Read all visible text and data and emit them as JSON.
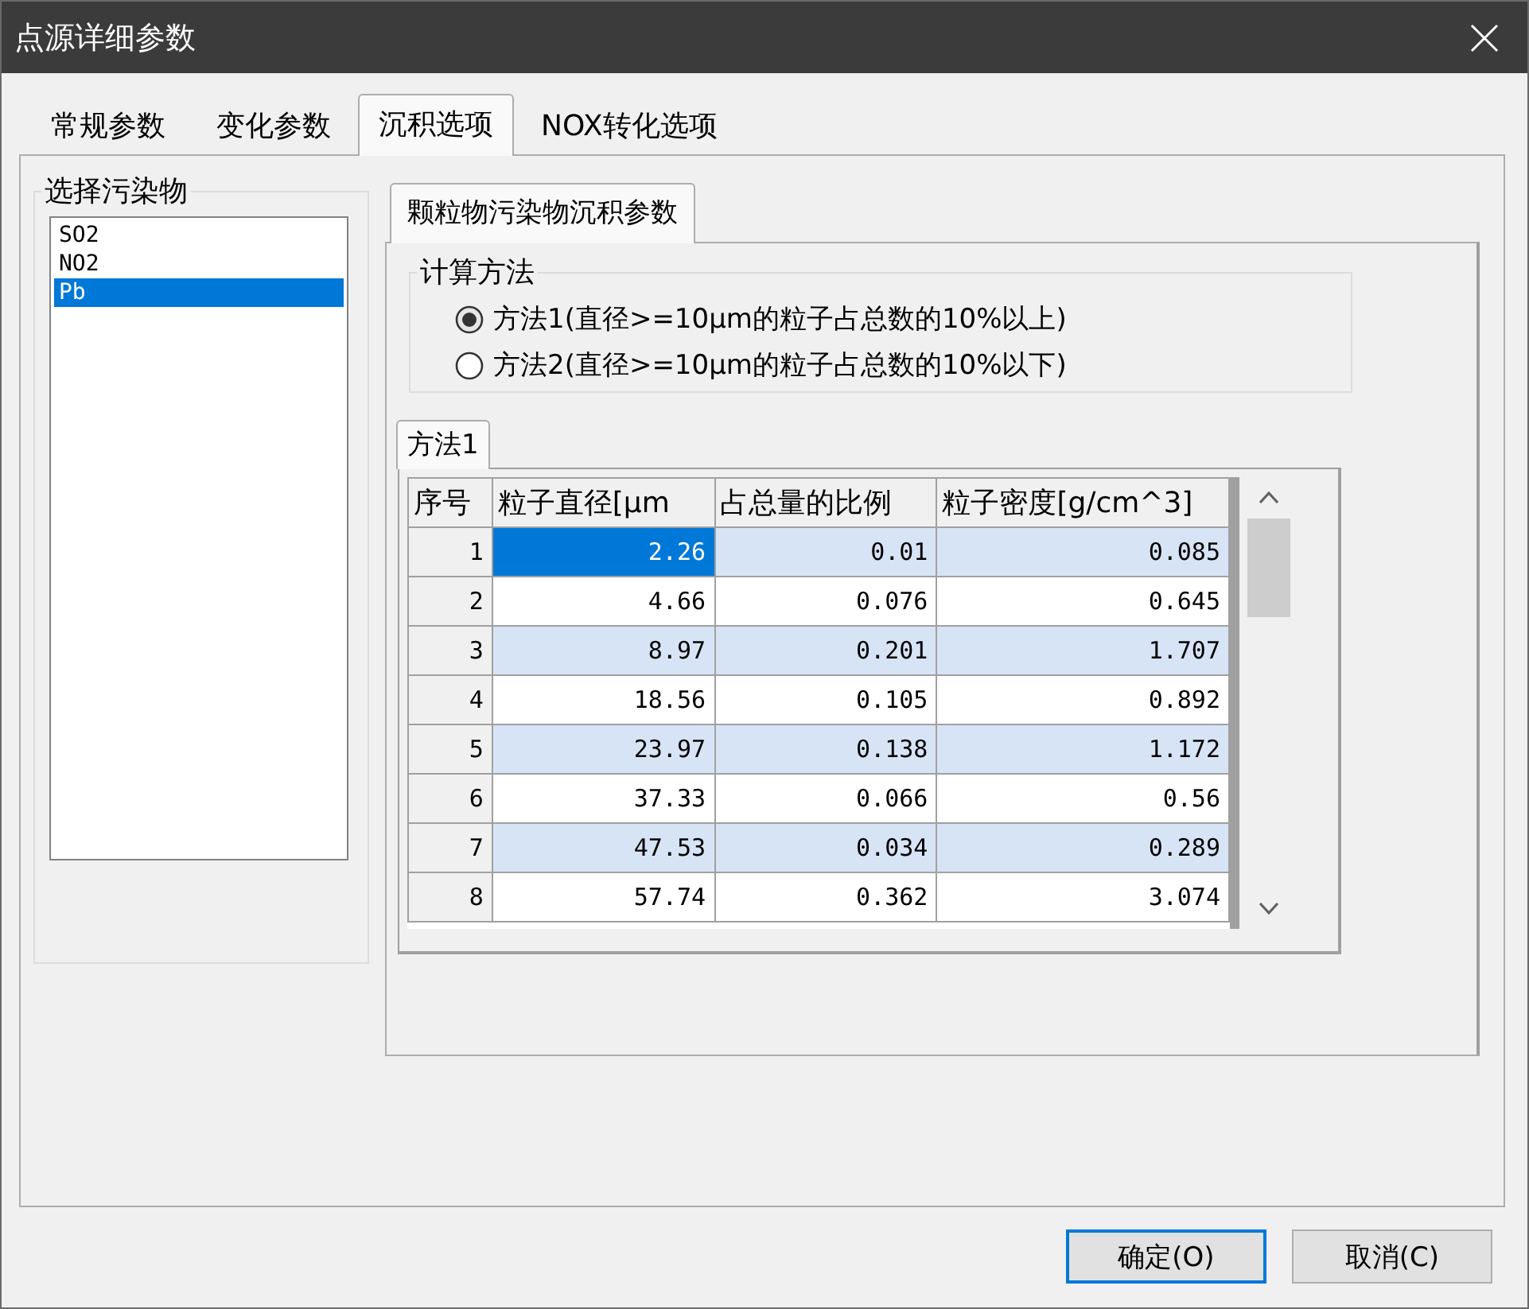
{
  "window": {
    "title": "点源详细参数"
  },
  "tabs": [
    {
      "label": "常规参数",
      "selected": false
    },
    {
      "label": "变化参数",
      "selected": false
    },
    {
      "label": "沉积选项",
      "selected": true
    },
    {
      "label": "NOX转化选项",
      "selected": false
    }
  ],
  "pollutants": {
    "title": "选择污染物",
    "items": [
      {
        "label": "SO2",
        "selected": false
      },
      {
        "label": "NO2",
        "selected": false
      },
      {
        "label": "Pb",
        "selected": true
      }
    ]
  },
  "inner_tabs": [
    {
      "label": "颗粒物污染物沉积参数",
      "selected": true
    }
  ],
  "method": {
    "title": "计算方法",
    "options": [
      {
        "label": "方法1(直径>=10μm的粒子占总数的10%以上)",
        "selected": true
      },
      {
        "label": "方法2(直径>=10μm的粒子占总数的10%以下)",
        "selected": false
      }
    ]
  },
  "table_tabs": [
    {
      "label": "方法1",
      "selected": true
    }
  ],
  "table": {
    "columns": [
      "序号",
      "粒子直径[μm",
      "占总量的比例",
      "粒子密度[g/cm^3]"
    ],
    "rows": [
      {
        "cells": [
          {
            "text": "1",
            "selected": false
          },
          {
            "text": "2.26",
            "selected": true
          },
          {
            "text": "0.01",
            "selected": false
          },
          {
            "text": "0.085",
            "selected": false
          }
        ]
      },
      {
        "cells": [
          {
            "text": "2",
            "selected": false
          },
          {
            "text": "4.66",
            "selected": false
          },
          {
            "text": "0.076",
            "selected": false
          },
          {
            "text": "0.645",
            "selected": false
          }
        ]
      },
      {
        "cells": [
          {
            "text": "3",
            "selected": false
          },
          {
            "text": "8.97",
            "selected": false
          },
          {
            "text": "0.201",
            "selected": false
          },
          {
            "text": "1.707",
            "selected": false
          }
        ]
      },
      {
        "cells": [
          {
            "text": "4",
            "selected": false
          },
          {
            "text": "18.56",
            "selected": false
          },
          {
            "text": "0.105",
            "selected": false
          },
          {
            "text": "0.892",
            "selected": false
          }
        ]
      },
      {
        "cells": [
          {
            "text": "5",
            "selected": false
          },
          {
            "text": "23.97",
            "selected": false
          },
          {
            "text": "0.138",
            "selected": false
          },
          {
            "text": "1.172",
            "selected": false
          }
        ]
      },
      {
        "cells": [
          {
            "text": "6",
            "selected": false
          },
          {
            "text": "37.33",
            "selected": false
          },
          {
            "text": "0.066",
            "selected": false
          },
          {
            "text": "0.56",
            "selected": false
          }
        ]
      },
      {
        "cells": [
          {
            "text": "7",
            "selected": false
          },
          {
            "text": "47.53",
            "selected": false
          },
          {
            "text": "0.034",
            "selected": false
          },
          {
            "text": "0.289",
            "selected": false
          }
        ]
      },
      {
        "cells": [
          {
            "text": "8",
            "selected": false
          },
          {
            "text": "57.74",
            "selected": false
          },
          {
            "text": "0.362",
            "selected": false
          },
          {
            "text": "3.074",
            "selected": false
          }
        ]
      }
    ]
  },
  "buttons": [
    {
      "label": "确定(O)",
      "default": true
    },
    {
      "label": "取消(C)",
      "default": false
    }
  ]
}
